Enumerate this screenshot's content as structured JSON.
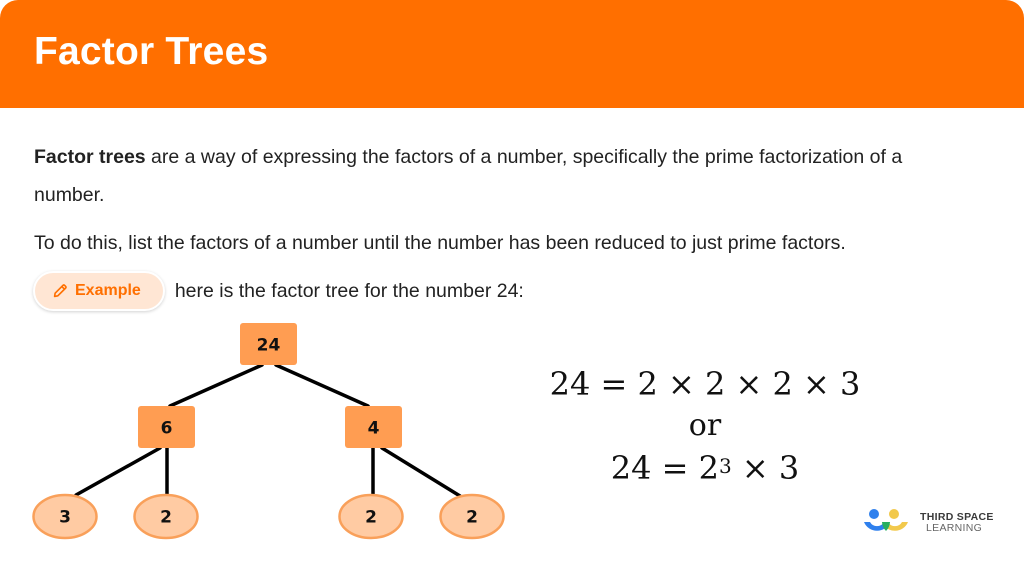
{
  "header": {
    "title": "Factor Trees"
  },
  "intro": {
    "bold_term": "Factor trees",
    "rest": " are a way of expressing the factors of a number, specifically the prime factorization of a number."
  },
  "instruction": "To do this, list the factors of a number until the number has been reduced to just prime factors.",
  "example": {
    "icon": "pencil-icon",
    "label": "Example",
    "text": "here is the factor tree for the number 24:"
  },
  "tree": {
    "root": "24",
    "level1": [
      "6",
      "4"
    ],
    "leaves": [
      "3",
      "2",
      "2",
      "2"
    ],
    "colors": {
      "box_fill": "#ff9d52",
      "leaf_fill": "#ffcba3",
      "leaf_stroke": "#f9a05a",
      "line": "#000000"
    }
  },
  "equations": {
    "line1": "24 = 2 × 2 × 2 × 3",
    "or": "or",
    "line2_base": "24 = 2",
    "line2_exp": "3",
    "line2_tail": " × 3"
  },
  "logo": {
    "line1": "THIRD SPACE",
    "line2": "LEARNING"
  },
  "colors": {
    "brand_orange": "#ff6f00",
    "pill_bg": "#ffe6d4"
  }
}
